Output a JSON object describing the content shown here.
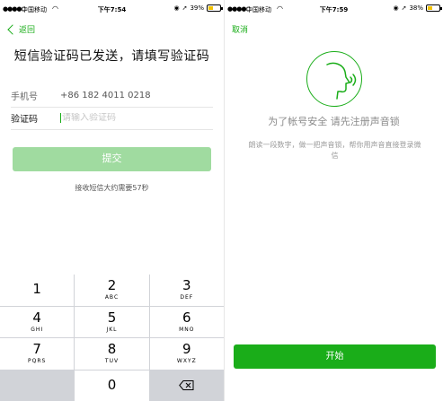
{
  "left_screen": {
    "status_bar": {
      "carrier": "中国移动",
      "time": "下午7:54",
      "battery": "39%"
    },
    "back_label": "返回",
    "title": "短信验证码已发送，请填写验证码",
    "phone_label": "手机号",
    "phone_value": "+86 182 4011 0218",
    "code_label": "验证码",
    "code_placeholder": "请输入验证码",
    "submit_label": "提交",
    "resend_text": "接收短信大约需要57秒",
    "keypad": [
      {
        "num": "1",
        "sub": ""
      },
      {
        "num": "2",
        "sub": "ABC"
      },
      {
        "num": "3",
        "sub": "DEF"
      },
      {
        "num": "4",
        "sub": "GHI"
      },
      {
        "num": "5",
        "sub": "JKL"
      },
      {
        "num": "6",
        "sub": "MNO"
      },
      {
        "num": "7",
        "sub": "PQRS"
      },
      {
        "num": "8",
        "sub": "TUV"
      },
      {
        "num": "9",
        "sub": "WXYZ"
      },
      {
        "num": "0",
        "sub": ""
      }
    ]
  },
  "right_screen": {
    "status_bar": {
      "carrier": "中国移动",
      "time": "下午7:59",
      "battery": "38%"
    },
    "cancel_label": "取消",
    "title": "为了帐号安全 请先注册声音锁",
    "description": "朗读一段数字，做一把声音锁，帮你用声音直接登录微信",
    "start_label": "开始"
  },
  "colors": {
    "accent": "#1aad19",
    "disabled_button": "#a0dba0",
    "keypad_bg": "#d1d3d8"
  },
  "icons": [
    "chevron-left-icon",
    "wifi-icon",
    "battery-icon",
    "location-arrow-icon",
    "voice-face-icon",
    "backspace-icon"
  ]
}
